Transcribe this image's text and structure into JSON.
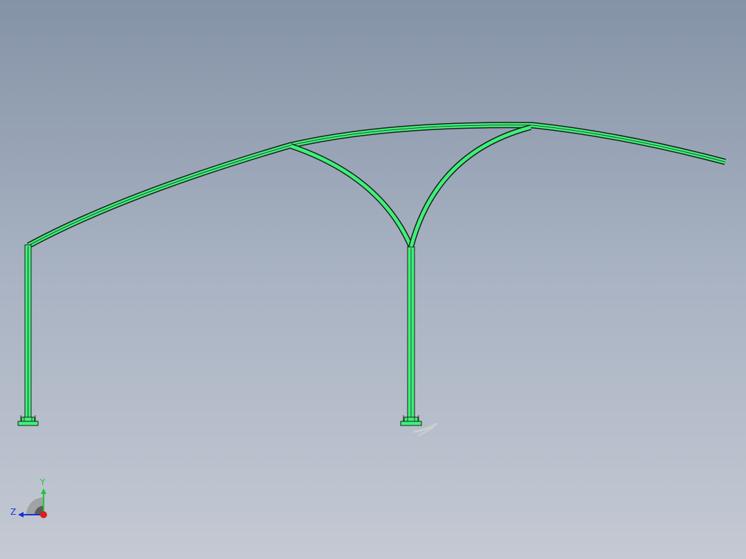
{
  "viewport": {
    "background_top": "#8593a7",
    "background_bottom": "#c4c9d3"
  },
  "model": {
    "member_color": "#3ef07a",
    "edge_color": "#1b1b1b"
  },
  "triad": {
    "y_label": "Y",
    "z_label": "Z",
    "y_color": "#18c63a",
    "z_color": "#1530d8",
    "x_color": "#e01c1c",
    "icons": [
      "view-triad-icon"
    ]
  }
}
